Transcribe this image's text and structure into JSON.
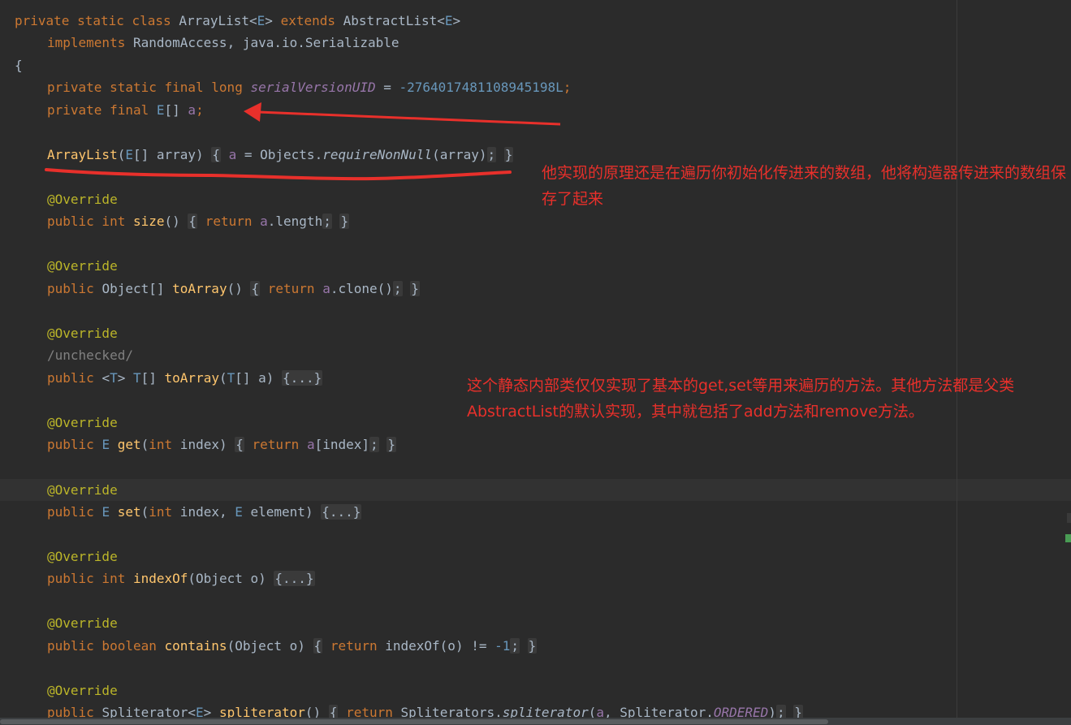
{
  "code": {
    "class_decl": {
      "private": "private",
      "static": "static",
      "class": "class",
      "name": "ArrayList<",
      "type_param": "E",
      "close": "> ",
      "extends": "extends",
      "super": "AbstractList<",
      "super_param": "E",
      "super_close": ">"
    },
    "implements_line": {
      "implements": "implements",
      "rest": "RandomAccess, java.io.Serializable"
    },
    "open_brace": "{",
    "serial": {
      "mods": "private static final long",
      "name": "serialVersionUID",
      "eq": " = ",
      "value": "-2764017481108945198L",
      "semi": ";"
    },
    "field_a": {
      "mods": "private final",
      "type": "E",
      "rest": "[] ",
      "name": "a",
      "semi": ";"
    },
    "constructor": {
      "name": "ArrayList",
      "p1": "(",
      "type": "E",
      "params": "[] array) ",
      "open": "{",
      "field": "a",
      "mid": " = Objects.",
      "call": "requireNonNull",
      "args": "(array)",
      "semi": ";",
      "close": "}"
    },
    "override": "@Override",
    "size_method": {
      "mods": "public int",
      "name": "size",
      "params": "()",
      "open": "{",
      "ret": "return",
      "field": "a",
      "rest": ".length",
      "semi": ";",
      "close": "}"
    },
    "toarray_method": {
      "mods": "public",
      "type": "Object[]",
      "name": "toArray",
      "params": "()",
      "open": "{",
      "ret": "return",
      "field": "a",
      "rest": ".clone()",
      "semi": ";",
      "close": "}"
    },
    "unchecked_comment": "/unchecked/",
    "toarray_t_method": {
      "mods": "public",
      "lt": "<",
      "tp": "T",
      "gt": "> ",
      "tp2": "T",
      "arr": "[] ",
      "name": "toArray",
      "p1": "(",
      "tp3": "T",
      "params": "[] a) ",
      "folded": "{...}"
    },
    "get_method": {
      "mods": "public",
      "type": "E",
      "name": "get",
      "p1": "(",
      "kw_int": "int",
      "params": " index) ",
      "open": "{",
      "ret": "return",
      "field": "a",
      "rest": "[index]",
      "semi": ";",
      "close": "}"
    },
    "set_method": {
      "mods": "public",
      "type": "E",
      "name": "set",
      "p1": "(",
      "kw_int": "int",
      "p2": " index, ",
      "tp": "E",
      "params": " element) ",
      "folded": "{...}"
    },
    "indexof_method": {
      "mods": "public int",
      "name": "indexOf",
      "params": "(Object o) ",
      "folded": "{...}"
    },
    "contains_method": {
      "mods": "public boolean",
      "name": "contains",
      "params": "(Object o)",
      "open": "{",
      "ret": "return",
      "rest": " indexOf(o) != ",
      "num": "-1",
      "semi": ";",
      "close": "}"
    },
    "spliterator_method": {
      "mods": "public",
      "type": "Spliterator<",
      "tp": "E",
      "gt": "> ",
      "name": "spliterator",
      "params": "()",
      "open": "{",
      "ret": "return",
      "call_obj": " Spliterators.",
      "call": "spliterator",
      "p1": "(",
      "field": "a",
      "p2": ", Spliterator.",
      "const": "ORDERED",
      "p3": ")",
      "semi": ";",
      "close": "}"
    }
  },
  "annotations": {
    "note1": "他实现的原理还是在遍历你初始化传进来的数组，他将构造器传进来的数组保存了起来",
    "note2": "这个静态内部类仅仅实现了基本的get,set等用来遍历的方法。其他方法都是父类AbstractList的默认实现，其中就包括了add方法和remove方法。"
  },
  "colors": {
    "background": "#2b2b2b",
    "keyword": "#cc7832",
    "number": "#6897bb",
    "annotation": "#bbb529",
    "method": "#ffc66d",
    "field": "#9876aa",
    "default_text": "#a9b7c6",
    "markup_red": "#e8302b"
  }
}
